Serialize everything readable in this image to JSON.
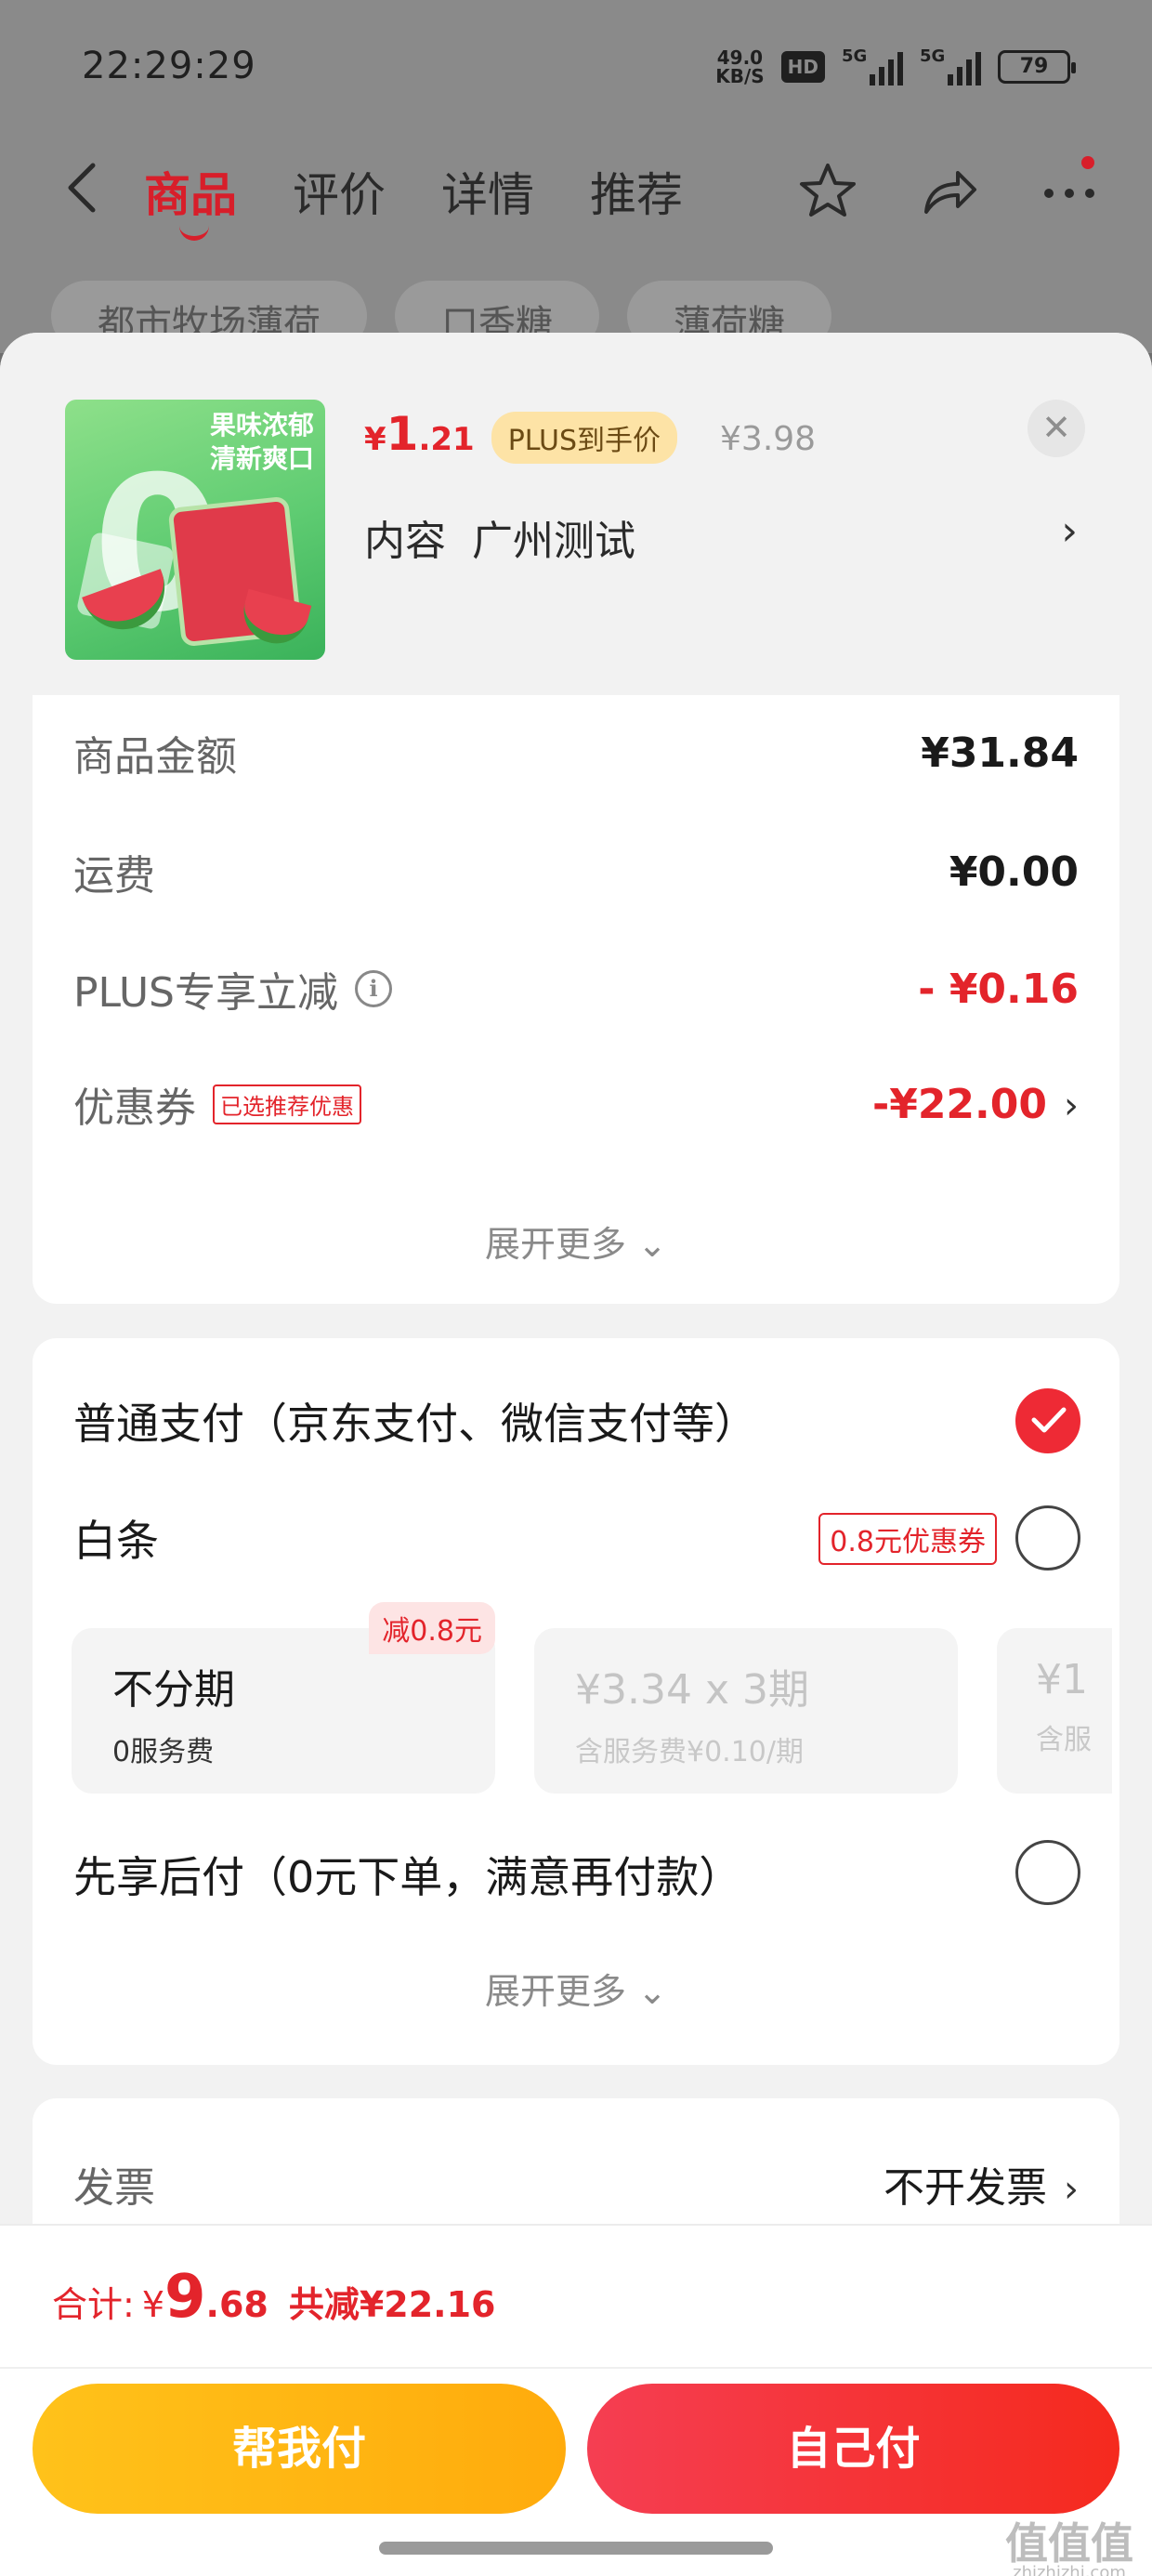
{
  "status_bar": {
    "time": "22:29:29",
    "net_speed_value": "49.0",
    "net_speed_unit": "KB/S",
    "hd_label": "HD",
    "sim1_label": "5G",
    "sim2_label": "5G",
    "battery": "79"
  },
  "nav": {
    "tabs": [
      {
        "label": "商品",
        "active": true
      },
      {
        "label": "评价",
        "active": false
      },
      {
        "label": "详情",
        "active": false
      },
      {
        "label": "推荐",
        "active": false
      }
    ],
    "icons": [
      "back-icon",
      "star-icon",
      "share-icon",
      "more-icon"
    ]
  },
  "background_search": {
    "search_text": "都市牧场薄荷",
    "pill_1": "口香糖",
    "pill_2": "薄荷糖"
  },
  "product": {
    "image_slogan_1": "果味浓郁",
    "image_slogan_2": "清新爽口",
    "price_symbol": "¥",
    "price_int": "1",
    "price_dec": ".21",
    "plus_tag": "PLUS到手价",
    "original_price": "¥3.98",
    "spec_label": "内容",
    "spec_value": "广州测试"
  },
  "amount": {
    "goods_label": "商品金额",
    "goods_value": "¥31.84",
    "shipping_label": "运费",
    "shipping_value": "¥0.00",
    "plus_label": "PLUS专享立减",
    "plus_value": "- ¥0.16",
    "coupon_label": "优惠券",
    "coupon_badge": "已选推荐优惠",
    "coupon_value": "-¥22.00",
    "expand_label": "展开更多"
  },
  "payment": {
    "normal_label": "普通支付（京东支付、微信支付等）",
    "normal_checked": true,
    "baitiao_label": "白条",
    "baitiao_coupon": "0.8元优惠券",
    "plans": [
      {
        "title": "不分期",
        "sub": "0服务费",
        "badge": "减0.8元",
        "enabled": true
      },
      {
        "title": "¥3.34 x 3期",
        "sub": "含服务费¥0.10/期",
        "enabled": false
      },
      {
        "title": "¥1",
        "sub": "含服",
        "enabled": false
      }
    ],
    "later_label": "先享后付（0元下单，满意再付款）",
    "expand_label": "展开更多"
  },
  "invoice": {
    "label": "发票",
    "value": "不开发票"
  },
  "bottom": {
    "total_label": "合计:",
    "total_symbol": "¥",
    "total_int": "9",
    "total_dec": ".68",
    "reduce_text": "共减¥22.16",
    "help_pay_label": "帮我付",
    "self_pay_label": "自己付",
    "watermark": "值值值",
    "watermark_url": "zhizhizhi.com"
  },
  "colors": {
    "accent_red": "#e3242b",
    "checked_red": "#ee2a35",
    "help_button": "#ffb812",
    "self_button": "#f5303a",
    "plus_tag_bg": "#fde3a6"
  }
}
